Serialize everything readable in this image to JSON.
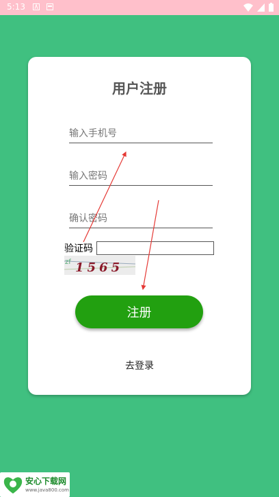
{
  "status_bar": {
    "time": "5:13",
    "icons": [
      "a-icon",
      "card-icon",
      "wifi-icon",
      "signal-icon",
      "battery-icon"
    ]
  },
  "form": {
    "title": "用户注册",
    "phone_placeholder": "输入手机号",
    "password_placeholder": "输入密码",
    "confirm_placeholder": "确认密码",
    "captcha_label": "验证码",
    "captcha_value": "",
    "captcha_image_text": "1565",
    "captcha_background_text": "zf",
    "submit_label": "注册",
    "login_link": "去登录"
  },
  "annotations": {
    "arrow_color": "#e53935"
  },
  "watermark": {
    "title": "安心下载网",
    "url": "www.java800.com"
  },
  "colors": {
    "background": "#40c080",
    "status_bar": "#ffc0cb",
    "button": "#22a010"
  }
}
